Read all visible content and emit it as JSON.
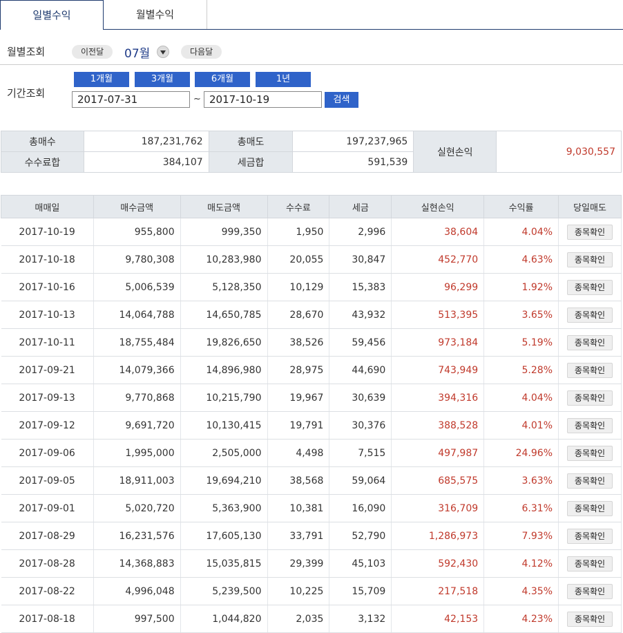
{
  "tabs": [
    {
      "label": "일별수익",
      "active": true
    },
    {
      "label": "월별수익",
      "active": false
    }
  ],
  "monthly_query": {
    "label": "월별조회",
    "prev_label": "이전달",
    "current_month": "07월",
    "next_label": "다음달"
  },
  "period_query": {
    "label": "기간조회",
    "buttons": [
      "1개월",
      "3개월",
      "6개월",
      "1년"
    ],
    "start_date": "2017-07-31",
    "separator": "~",
    "end_date": "2017-10-19",
    "search_label": "검색"
  },
  "summary": {
    "total_buy_label": "총매수",
    "total_buy": "187,231,762",
    "total_sell_label": "총매도",
    "total_sell": "197,237,965",
    "fee_label": "수수료합",
    "fee": "384,107",
    "tax_label": "세금합",
    "tax": "591,539",
    "realized_label": "실현손익",
    "realized": "9,030,557"
  },
  "table": {
    "headers": [
      "매매일",
      "매수금액",
      "매도금액",
      "수수료",
      "세금",
      "실현손익",
      "수익률",
      "당일매도"
    ],
    "action_label": "종목확인",
    "rows": [
      {
        "date": "2017-10-19",
        "buy": "955,800",
        "sell": "999,350",
        "fee": "1,950",
        "tax": "2,996",
        "profit": "38,604",
        "rate": "4.04%"
      },
      {
        "date": "2017-10-18",
        "buy": "9,780,308",
        "sell": "10,283,980",
        "fee": "20,055",
        "tax": "30,847",
        "profit": "452,770",
        "rate": "4.63%"
      },
      {
        "date": "2017-10-16",
        "buy": "5,006,539",
        "sell": "5,128,350",
        "fee": "10,129",
        "tax": "15,383",
        "profit": "96,299",
        "rate": "1.92%"
      },
      {
        "date": "2017-10-13",
        "buy": "14,064,788",
        "sell": "14,650,785",
        "fee": "28,670",
        "tax": "43,932",
        "profit": "513,395",
        "rate": "3.65%"
      },
      {
        "date": "2017-10-11",
        "buy": "18,755,484",
        "sell": "19,826,650",
        "fee": "38,526",
        "tax": "59,456",
        "profit": "973,184",
        "rate": "5.19%"
      },
      {
        "date": "2017-09-21",
        "buy": "14,079,366",
        "sell": "14,896,980",
        "fee": "28,975",
        "tax": "44,690",
        "profit": "743,949",
        "rate": "5.28%"
      },
      {
        "date": "2017-09-13",
        "buy": "9,770,868",
        "sell": "10,215,790",
        "fee": "19,967",
        "tax": "30,639",
        "profit": "394,316",
        "rate": "4.04%"
      },
      {
        "date": "2017-09-12",
        "buy": "9,691,720",
        "sell": "10,130,415",
        "fee": "19,791",
        "tax": "30,376",
        "profit": "388,528",
        "rate": "4.01%"
      },
      {
        "date": "2017-09-06",
        "buy": "1,995,000",
        "sell": "2,505,000",
        "fee": "4,498",
        "tax": "7,515",
        "profit": "497,987",
        "rate": "24.96%"
      },
      {
        "date": "2017-09-05",
        "buy": "18,911,003",
        "sell": "19,694,210",
        "fee": "38,568",
        "tax": "59,064",
        "profit": "685,575",
        "rate": "3.63%"
      },
      {
        "date": "2017-09-01",
        "buy": "5,020,720",
        "sell": "5,363,900",
        "fee": "10,381",
        "tax": "16,090",
        "profit": "316,709",
        "rate": "6.31%"
      },
      {
        "date": "2017-08-29",
        "buy": "16,231,576",
        "sell": "17,605,130",
        "fee": "33,791",
        "tax": "52,790",
        "profit": "1,286,973",
        "rate": "7.93%"
      },
      {
        "date": "2017-08-28",
        "buy": "14,368,883",
        "sell": "15,035,815",
        "fee": "29,399",
        "tax": "45,103",
        "profit": "592,430",
        "rate": "4.12%"
      },
      {
        "date": "2017-08-22",
        "buy": "4,996,048",
        "sell": "5,239,500",
        "fee": "10,225",
        "tax": "15,709",
        "profit": "217,518",
        "rate": "4.35%"
      },
      {
        "date": "2017-08-18",
        "buy": "997,500",
        "sell": "1,044,820",
        "fee": "2,035",
        "tax": "3,132",
        "profit": "42,153",
        "rate": "4.23%"
      }
    ]
  },
  "colors": {
    "accent": "#2f63c9",
    "tab_border": "#1e3a6e",
    "profit": "#c0392b",
    "header_bg": "#e5e9ed"
  }
}
